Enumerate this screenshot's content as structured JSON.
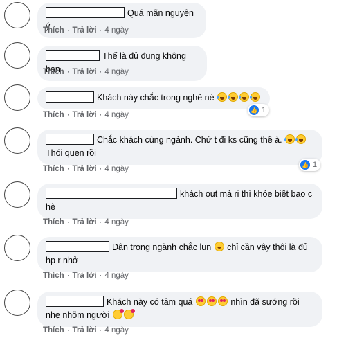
{
  "actions": {
    "like": "Thích",
    "reply": "Trả lời",
    "separator": "·"
  },
  "comments": [
    {
      "text": "Quá mãn nguyện ý",
      "time": "4 ngày"
    },
    {
      "text": "Thế là đủ đung không bạn",
      "time": "4 ngày"
    },
    {
      "text": "Khách này chắc trong nghề nè",
      "time": "4 ngày",
      "reactions": {
        "icon": "like-icon",
        "count": "1"
      }
    },
    {
      "text": "Chắc khách cùng ngành. Chứ t đi ks cũng thế à.",
      "text2": "Thói quen rồi",
      "time": "4 ngày",
      "reactions": {
        "icon": "like-icon",
        "count": "1"
      }
    },
    {
      "text": "khách out mà ri thì khỏe biết bao c",
      "text2": "hè",
      "time": "4 ngày"
    },
    {
      "text": "Dân trong ngành chắc lun",
      "text_b": "chỉ cần vậy thôi là đủ",
      "text2": "hp r nhở",
      "time": "4 ngày"
    },
    {
      "text": "Khách này có tâm quá",
      "text_b": "nhìn đã sướng rồi",
      "text2": "nhẹ nhõm người",
      "time": "4 ngày"
    }
  ],
  "colors": {
    "bubble": "#f0f2f5",
    "like_blue": "#1877f2",
    "meta_gray": "#65676b"
  }
}
